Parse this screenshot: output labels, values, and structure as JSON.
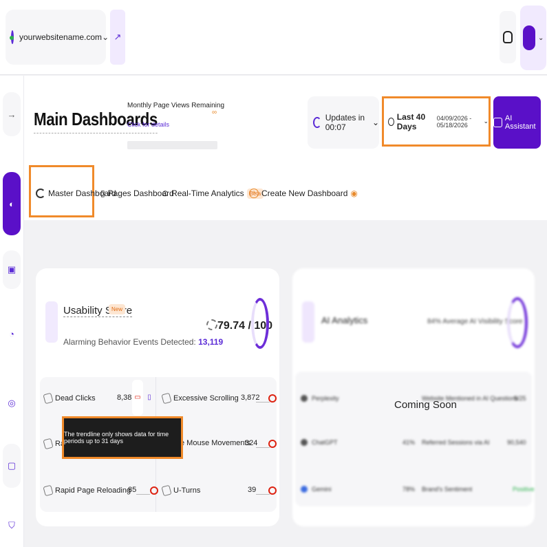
{
  "site": {
    "name": "yourwebsitename.com"
  },
  "header": {
    "title": "Main Dashboards",
    "page_views_title": "Monthly Page Views Remaining",
    "page_views_link": "Click for details",
    "page_views_value": "∞",
    "updates": "Updates in 00:07",
    "date_label": "Last 40 Days",
    "date_range": "04/09/2026 - 05/18/2026",
    "ai_button": "AI Assistant"
  },
  "tabs": [
    {
      "label": "Master Dashboard"
    },
    {
      "label": "Pages Dashboard"
    },
    {
      "label": "Real-Time Analytics",
      "badge": "Beta"
    },
    {
      "label": "Create New Dashboard"
    }
  ],
  "usability": {
    "title": "Usability Score",
    "badge": "New",
    "alarm_label": "Alarming Behavior Events Detected:",
    "alarm_count": "13,119",
    "score": "79.74 / 100",
    "score_value": 79.74,
    "metrics": [
      {
        "label": "Dead Clicks",
        "value": "8,383"
      },
      {
        "label": "Excessive Scrolling",
        "value": "3,872"
      },
      {
        "label": "Rag",
        "value": ""
      },
      {
        "label": "e Mouse Movements",
        "value": "324"
      },
      {
        "label": "Rapid Page Reloading",
        "value": "85"
      },
      {
        "label": "U-Turns",
        "value": "39"
      }
    ],
    "tooltip": "The trendline only shows data for time periods up to 31 days"
  },
  "ai_analytics": {
    "title": "AI Analytics",
    "visibility": "84% Average AI Visibility Score",
    "coming_soon": "Coming Soon",
    "rows": [
      {
        "name": "Perplexity",
        "pct": "",
        "metric": "Website Mentioned in AI Questions",
        "value": "5/25"
      },
      {
        "name": "ChatGPT",
        "pct": "41%",
        "metric": "Referred Sessions via AI",
        "value": "90,540"
      },
      {
        "name": "Gemini",
        "pct": "78%",
        "metric": "Brand's Sentiment",
        "value": "Positive"
      }
    ]
  },
  "colors": {
    "accent": "#5a10c8",
    "highlight": "#f08a2a",
    "alert": "#dd2211"
  }
}
